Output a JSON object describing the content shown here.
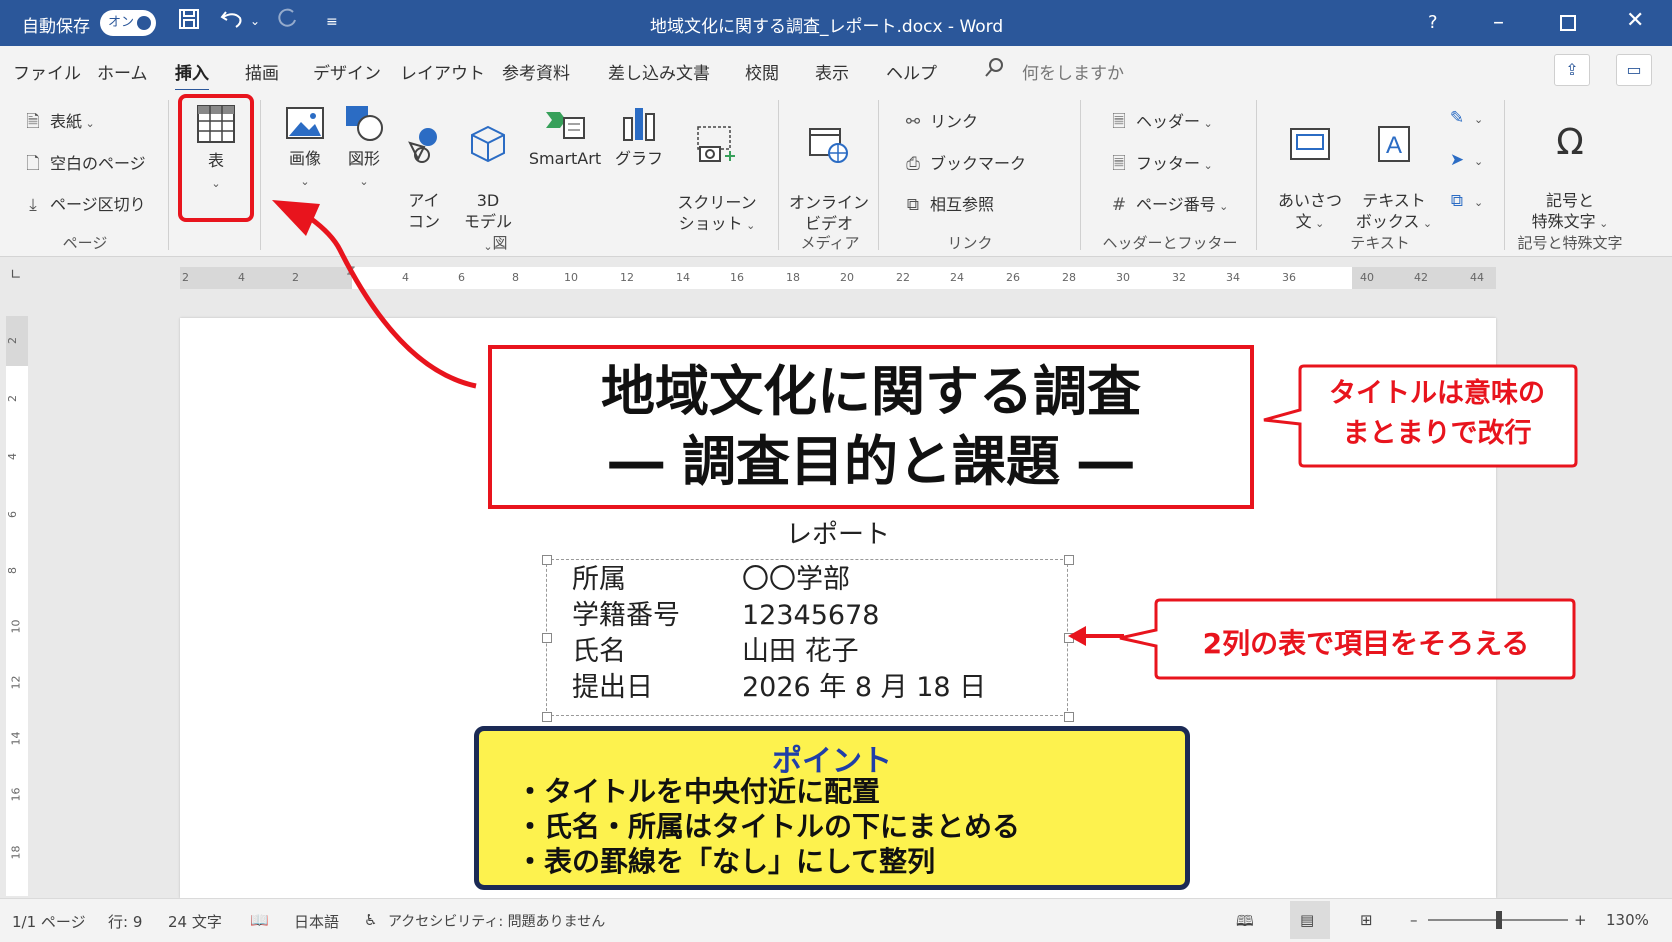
{
  "titlebar": {
    "autosave_label": "自動保存",
    "autosave_state": "オン",
    "document_title": "地域文化に関する調査_レポート.docx  -  Word",
    "help_icon": "?"
  },
  "menu": {
    "tabs": [
      "ファイル",
      "ホーム",
      "挿入",
      "描画",
      "デザイン",
      "レイアウト",
      "参考資料",
      "差し込み文書",
      "校閲",
      "表示",
      "ヘルプ"
    ],
    "active_tab": "挿入",
    "search_placeholder": "何をしますか"
  },
  "ribbon": {
    "page_group": {
      "label": "ページ",
      "items": [
        "表紙",
        "空白のページ",
        "ページ区切り"
      ]
    },
    "table_group": {
      "label": "表"
    },
    "figure_group": {
      "label": "図",
      "items": [
        "画像",
        "図形",
        "アイ\nコン",
        "3D\nモデル",
        "SmartArt",
        "グラフ",
        "スクリーン\nショット"
      ]
    },
    "media_group": {
      "label": "メディア",
      "item": "オンライン\nビデオ"
    },
    "link_group": {
      "label": "リンク",
      "items": [
        "リンク",
        "ブックマーク",
        "相互参照"
      ]
    },
    "header_group": {
      "label": "ヘッダーとフッター",
      "items": [
        "ヘッダー",
        "フッター",
        "ページ番号"
      ]
    },
    "text_group": {
      "label": "テキスト",
      "items": [
        "あいさつ\n文",
        "テキスト\nボックス"
      ]
    },
    "symbol_group": {
      "label": "記号と特殊文字",
      "item": "記号と\n特殊文字"
    }
  },
  "ruler": {
    "h_ticks": [
      "2",
      "4",
      "2",
      "4",
      "6",
      "8",
      "10",
      "12",
      "14",
      "16",
      "18",
      "20",
      "22",
      "24",
      "26",
      "28",
      "30",
      "32",
      "34",
      "36",
      "40",
      "42",
      "44"
    ],
    "v_ticks": [
      "2",
      "2",
      "4",
      "6",
      "8",
      "10",
      "12",
      "14",
      "16",
      "18"
    ]
  },
  "document": {
    "title_line1": "地域文化に関する調査",
    "title_line2": "― 調査目的と課題 ―",
    "subtitle": "レポート",
    "info_table": [
      {
        "label": "所属",
        "value": "〇〇学部"
      },
      {
        "label": "学籍番号",
        "value": "12345678"
      },
      {
        "label": "氏名",
        "value": "山田 花子"
      },
      {
        "label": "提出日",
        "value": "2026 年 8 月 18 日"
      }
    ]
  },
  "annotations": {
    "callout_title": "タイトルは意味の\nまとまりで改行",
    "callout_table": "2列の表で項目をそろえる",
    "point_heading": "ポイント",
    "point_items": [
      "・タイトルを中央付近に配置",
      "・氏名・所属はタイトルの下にまとめる",
      "・表の罫線を「なし」にして整列"
    ],
    "accent_red": "#e8141d",
    "point_bg": "#fdf24e",
    "point_border": "#1b2a55",
    "point_heading_color": "#1f3ea8"
  },
  "statusbar": {
    "page": "1/1 ページ",
    "line": "行: 9",
    "words": "24 文字",
    "language": "日本語",
    "accessibility": "アクセシビリティ: 問題ありません",
    "zoom": "130%"
  }
}
